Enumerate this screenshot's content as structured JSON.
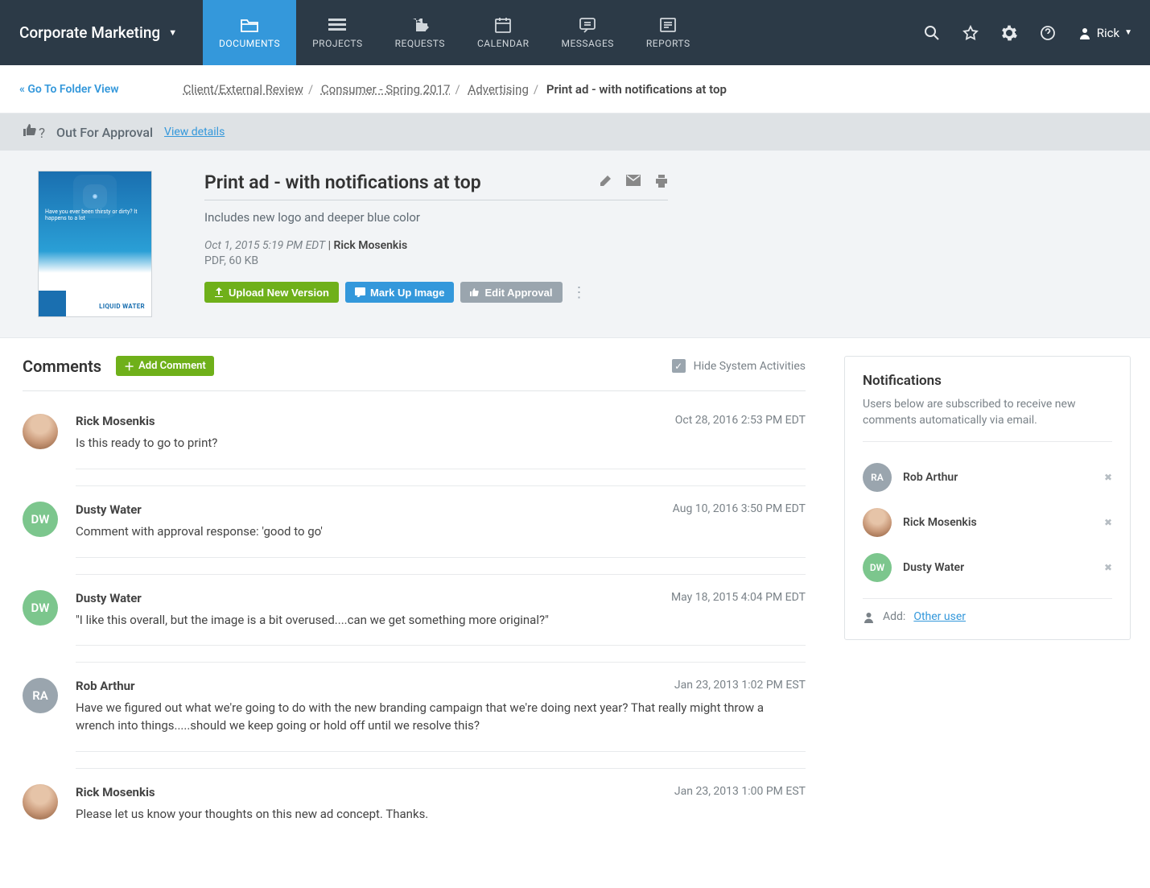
{
  "workspace": "Corporate Marketing",
  "nav": {
    "documents": "DOCUMENTS",
    "projects": "PROJECTS",
    "requests": "REQUESTS",
    "calendar": "CALENDAR",
    "messages": "MESSAGES",
    "reports": "REPORTS"
  },
  "user": {
    "name": "Rick"
  },
  "subbar": {
    "folder_link": "« Go To Folder View",
    "crumbs": {
      "c1": "Client/External Review",
      "c2": "Consumer - Spring 2017",
      "c3": "Advertising",
      "current": "Print ad - with notifications at top"
    }
  },
  "status": {
    "label": "Out For Approval",
    "view_details": "View details"
  },
  "document": {
    "title": "Print ad - with notifications at top",
    "description": "Includes new logo and deeper blue color",
    "date": "Oct 1, 2015 5:19 PM EDT",
    "author": "Rick Mosenkis",
    "fileinfo": "PDF, 60 KB",
    "thumb_headline": "Have you ever been thirsty or dirty? It happens to a lot",
    "thumb_brand": "LIQUID WATER",
    "buttons": {
      "upload": "Upload New Version",
      "markup": "Mark Up Image",
      "edit_approval": "Edit Approval"
    }
  },
  "comments": {
    "heading": "Comments",
    "add_label": "Add Comment",
    "hide_label": "Hide System Activities",
    "items": [
      {
        "user": "Rick Mosenkis",
        "avatar": "rm",
        "initials": "",
        "date": "Oct 28, 2016 2:53 PM EDT",
        "text": "Is this ready to go to print?"
      },
      {
        "user": "Dusty Water",
        "avatar": "dw",
        "initials": "DW",
        "date": "Aug 10, 2016 3:50 PM EDT",
        "text": "Comment with approval response: 'good to go'"
      },
      {
        "user": "Dusty Water",
        "avatar": "dw",
        "initials": "DW",
        "date": "May 18, 2015 4:04 PM EDT",
        "text": "\"I like this overall, but the image is a bit overused....can we get something more original?\""
      },
      {
        "user": "Rob Arthur",
        "avatar": "ra",
        "initials": "RA",
        "date": "Jan 23, 2013 1:02 PM EST",
        "text": "Have we figured out what we're going to do with the new branding campaign that we're doing next year? That really might throw a wrench into things.....should we keep going or hold off until we resolve this?"
      },
      {
        "user": "Rick Mosenkis",
        "avatar": "rm",
        "initials": "",
        "date": "Jan 23, 2013 1:00 PM EST",
        "text": "Please let us know your thoughts on this new ad concept. Thanks."
      }
    ]
  },
  "notifications": {
    "heading": "Notifications",
    "description": "Users below are subscribed to receive new comments automatically via email.",
    "users": [
      {
        "name": "Rob Arthur",
        "avatar": "ra",
        "initials": "RA"
      },
      {
        "name": "Rick Mosenkis",
        "avatar": "rm",
        "initials": ""
      },
      {
        "name": "Dusty Water",
        "avatar": "dw",
        "initials": "DW"
      }
    ],
    "add_label": "Add:",
    "other_user": "Other user"
  }
}
